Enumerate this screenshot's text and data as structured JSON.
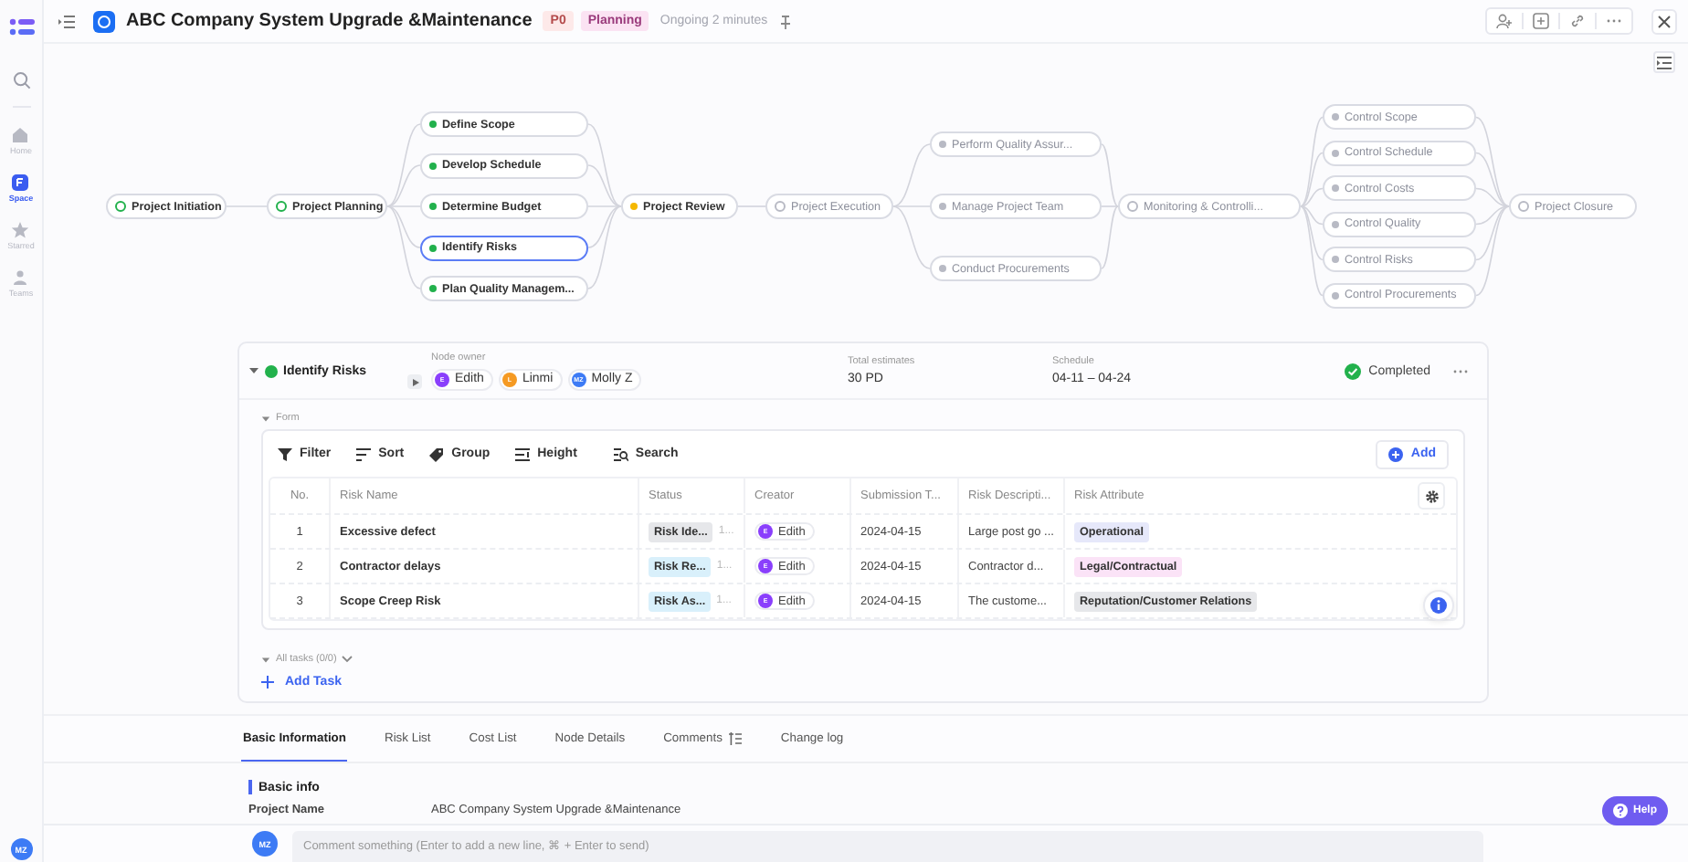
{
  "sidebar": {
    "items": [
      {
        "label": "Home",
        "kind": "home",
        "selected": false
      },
      {
        "label": "Space",
        "kind": "space",
        "selected": true
      },
      {
        "label": "Starred",
        "kind": "star",
        "selected": false
      },
      {
        "label": "Teams",
        "kind": "teams",
        "selected": false
      }
    ],
    "user_avatar": "MZ"
  },
  "header": {
    "title": "ABC Company System Upgrade &Maintenance",
    "priority": "P0",
    "phase": "Planning",
    "duration": "Ongoing 2 minutes"
  },
  "flow": {
    "columns": [
      [
        {
          "label": "Project Initiation",
          "kind": "phase",
          "color": "#22b14c",
          "disabled": false,
          "selected": false
        }
      ],
      [
        {
          "label": "Project Planning",
          "kind": "phase",
          "color": "#22b14c",
          "disabled": false,
          "selected": false
        }
      ],
      [
        {
          "label": "Define Scope",
          "kind": "task",
          "color": "#22b14c",
          "disabled": false,
          "selected": false
        },
        {
          "label": "Develop Schedule",
          "kind": "task",
          "color": "#22b14c",
          "disabled": false,
          "selected": false
        },
        {
          "label": "Determine Budget",
          "kind": "task",
          "color": "#22b14c",
          "disabled": false,
          "selected": false
        },
        {
          "label": "Identify Risks",
          "kind": "task",
          "color": "#22b14c",
          "disabled": false,
          "selected": true
        },
        {
          "label": "Plan Quality Managem...",
          "kind": "task",
          "color": "#22b14c",
          "disabled": false,
          "selected": false
        }
      ],
      [
        {
          "label": "Project Review",
          "kind": "task",
          "color": "#f5b800",
          "disabled": false,
          "selected": false
        }
      ],
      [
        {
          "label": "Project Execution",
          "kind": "phase",
          "color": "#b8bac4",
          "disabled": true,
          "selected": false
        }
      ],
      [
        {
          "label": "Perform Quality Assur...",
          "kind": "task",
          "color": "#b8bac4",
          "disabled": true,
          "selected": false
        },
        {
          "label": "Manage Project Team",
          "kind": "task",
          "color": "#b8bac4",
          "disabled": true,
          "selected": false
        },
        {
          "label": "Conduct Procurements",
          "kind": "task",
          "color": "#b8bac4",
          "disabled": true,
          "selected": false
        }
      ],
      [
        {
          "label": "Monitoring & Controlli...",
          "kind": "phase",
          "color": "#b8bac4",
          "disabled": true,
          "selected": false
        }
      ],
      [
        {
          "label": "Control Scope",
          "kind": "task",
          "color": "#b8bac4",
          "disabled": true,
          "selected": false
        },
        {
          "label": "Control Schedule",
          "kind": "task",
          "color": "#b8bac4",
          "disabled": true,
          "selected": false
        },
        {
          "label": "Control Costs",
          "kind": "task",
          "color": "#b8bac4",
          "disabled": true,
          "selected": false
        },
        {
          "label": "Control Quality",
          "kind": "task",
          "color": "#b8bac4",
          "disabled": true,
          "selected": false
        },
        {
          "label": "Control Risks",
          "kind": "task",
          "color": "#b8bac4",
          "disabled": true,
          "selected": false
        },
        {
          "label": "Control Procurements",
          "kind": "task",
          "color": "#b8bac4",
          "disabled": true,
          "selected": false
        }
      ],
      [
        {
          "label": "Project Closure",
          "kind": "phase",
          "color": "#b8bac4",
          "disabled": true,
          "selected": false
        }
      ]
    ]
  },
  "detail": {
    "title": "Identify Risks",
    "color": "#22b14c",
    "owner_label": "Node owner",
    "owners": [
      {
        "initials": "E",
        "name": "Edith",
        "color": "#8a3ffc"
      },
      {
        "initials": "L",
        "name": "Linmi",
        "color": "#f59a23"
      },
      {
        "initials": "MZ",
        "name": "Molly Z",
        "color": "#3d7bf5"
      }
    ],
    "estimate_label": "Total estimates",
    "estimate": "30 PD",
    "schedule_label": "Schedule",
    "schedule": "04-11 – 04-24",
    "state": "Completed",
    "form": {
      "label": "Form",
      "toolbar": [
        {
          "label": "Filter",
          "kind": "filter"
        },
        {
          "label": "Sort",
          "kind": "sort"
        },
        {
          "label": "Group",
          "kind": "group"
        },
        {
          "label": "Height",
          "kind": "height"
        },
        {
          "label": "Search",
          "kind": "search"
        }
      ],
      "add": "Add",
      "table": {
        "columns": [
          "No.",
          "Risk Name",
          "Status",
          "Creator",
          "Submission T...",
          "Risk Descripti...",
          "Risk Attribute"
        ],
        "rows": [
          {
            "no": "1",
            "name": "Excessive defect",
            "status": {
              "label": "Risk Ide...",
              "color": "#e6e7ea"
            },
            "status_extra": "1...",
            "creator": {
              "initial": "E",
              "name": "Edith"
            },
            "submitted": "2024-04-15",
            "description": "Large post go ...",
            "attribute": {
              "label": "Operational",
              "color": "#e6e8fa"
            }
          },
          {
            "no": "2",
            "name": "Contractor delays",
            "status": {
              "label": "Risk Re...",
              "color": "#d9f0fb"
            },
            "status_extra": "1...",
            "creator": {
              "initial": "E",
              "name": "Edith"
            },
            "submitted": "2024-04-15",
            "description": "Contractor d...",
            "attribute": {
              "label": "Legal/Contractual",
              "color": "#fbe3f7"
            }
          },
          {
            "no": "3",
            "name": "Scope Creep Risk",
            "status": {
              "label": "Risk As...",
              "color": "#d9f0fb"
            },
            "status_extra": "1...",
            "creator": {
              "initial": "E",
              "name": "Edith"
            },
            "submitted": "2024-04-15",
            "description": "The custome...",
            "attribute": {
              "label": "Reputation/Customer Relations",
              "color": "#e6e7ea"
            }
          }
        ]
      }
    },
    "all_tasks": "All tasks (0/0)",
    "add_task": "Add Task"
  },
  "tabs": [
    {
      "label": "Basic Information",
      "kind": "plain",
      "selected": true
    },
    {
      "label": "Risk List",
      "kind": "plain",
      "selected": false
    },
    {
      "label": "Cost List",
      "kind": "plain",
      "selected": false
    },
    {
      "label": "Node Details",
      "kind": "plain",
      "selected": false
    },
    {
      "label": "Comments",
      "kind": "filter",
      "selected": false
    },
    {
      "label": "Change log",
      "kind": "plain",
      "selected": false
    }
  ],
  "basic_info": {
    "heading": "Basic info",
    "fields": [
      {
        "label": "Project Name",
        "value": "ABC Company System Upgrade &Maintenance"
      }
    ]
  },
  "comment": {
    "avatar": "MZ",
    "placeholder": "Comment something (Enter to add a new line, ⌘ + Enter to send)"
  },
  "help": "Help"
}
